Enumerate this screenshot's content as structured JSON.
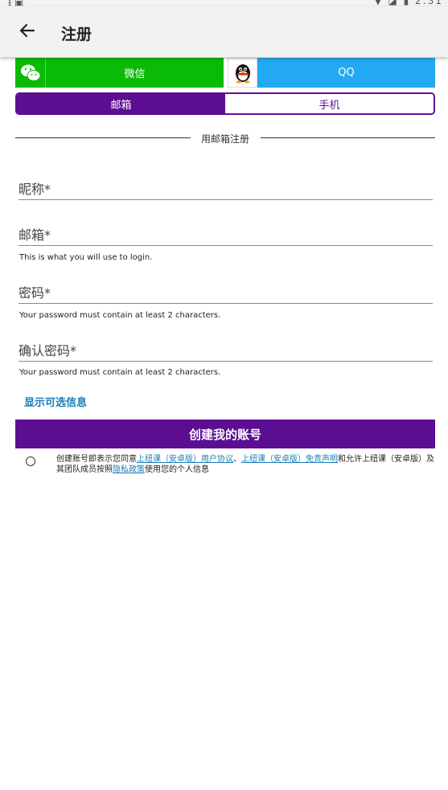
{
  "status_bar": {
    "left_icons": "⭳ ▣",
    "right_icons": "▼ ◪ ▮",
    "time": "2:31"
  },
  "app_bar": {
    "title": "注册"
  },
  "social": {
    "wechat_label": "微信",
    "qq_label": "QQ"
  },
  "tabs": [
    {
      "label": "邮箱",
      "active": true
    },
    {
      "label": "手机",
      "active": false
    }
  ],
  "divider_text": "用邮箱注册",
  "fields": {
    "nickname_label": "昵称*",
    "email_label": "邮箱*",
    "email_hint": "This is what you will use to login.",
    "password_label": "密码*",
    "password_hint": "Your password must contain at least 2 characters.",
    "confirm_label": "确认密码*",
    "confirm_hint": "Your password must contain at least 2 characters."
  },
  "optional_link": "显示可选信息",
  "create_button": "创建我的账号",
  "terms": {
    "prefix": "创建账号即表示您同意",
    "link1": "上纽课（安卓版）用户协议",
    "sep": "、",
    "link2": "上纽课（安卓版）免责声明",
    "middle": "和允许上纽课（安卓版）及其团队成员按照",
    "link3": "隐私政策",
    "suffix": "使用您的个人信息"
  },
  "colors": {
    "accent": "#5c0e93",
    "wechat": "#09bb07",
    "qq": "#23a8f2",
    "link": "#1b7db5"
  }
}
